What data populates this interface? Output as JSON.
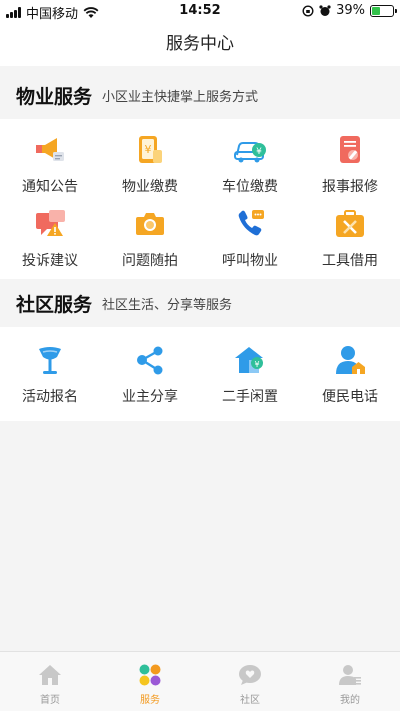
{
  "status_bar": {
    "carrier": "中国移动",
    "time": "14:52",
    "battery": "39%",
    "battery_level": 0.39
  },
  "nav": {
    "title": "服务中心"
  },
  "property_section": {
    "title": "物业服务",
    "subtitle": "小区业主快捷掌上服务方式",
    "items": [
      {
        "label": "通知公告",
        "icon": "megaphone-icon"
      },
      {
        "label": "物业缴费",
        "icon": "yuan-card-icon"
      },
      {
        "label": "车位缴费",
        "icon": "car-icon"
      },
      {
        "label": "报事报修",
        "icon": "repair-report-icon"
      },
      {
        "label": "投诉建议",
        "icon": "complaint-icon"
      },
      {
        "label": "问题随拍",
        "icon": "camera-icon"
      },
      {
        "label": "呼叫物业",
        "icon": "phone-call-icon"
      },
      {
        "label": "工具借用",
        "icon": "toolbox-icon"
      }
    ]
  },
  "community_section": {
    "title": "社区服务",
    "subtitle": "社区生活、分享等服务",
    "items": [
      {
        "label": "活动报名",
        "icon": "flag-icon"
      },
      {
        "label": "业主分享",
        "icon": "share-icon"
      },
      {
        "label": "二手闲置",
        "icon": "secondhand-icon"
      },
      {
        "label": "便民电话",
        "icon": "contact-icon"
      }
    ]
  },
  "tabbar": {
    "tabs": [
      {
        "label": "首页",
        "icon": "home-icon",
        "active": false
      },
      {
        "label": "服务",
        "icon": "services-icon",
        "active": true
      },
      {
        "label": "社区",
        "icon": "community-icon",
        "active": false
      },
      {
        "label": "我的",
        "icon": "profile-icon",
        "active": false
      }
    ]
  },
  "colors": {
    "accent": "#f39a1f",
    "blue": "#2f9be8",
    "red": "#f06a5e",
    "orange": "#f5a623"
  }
}
